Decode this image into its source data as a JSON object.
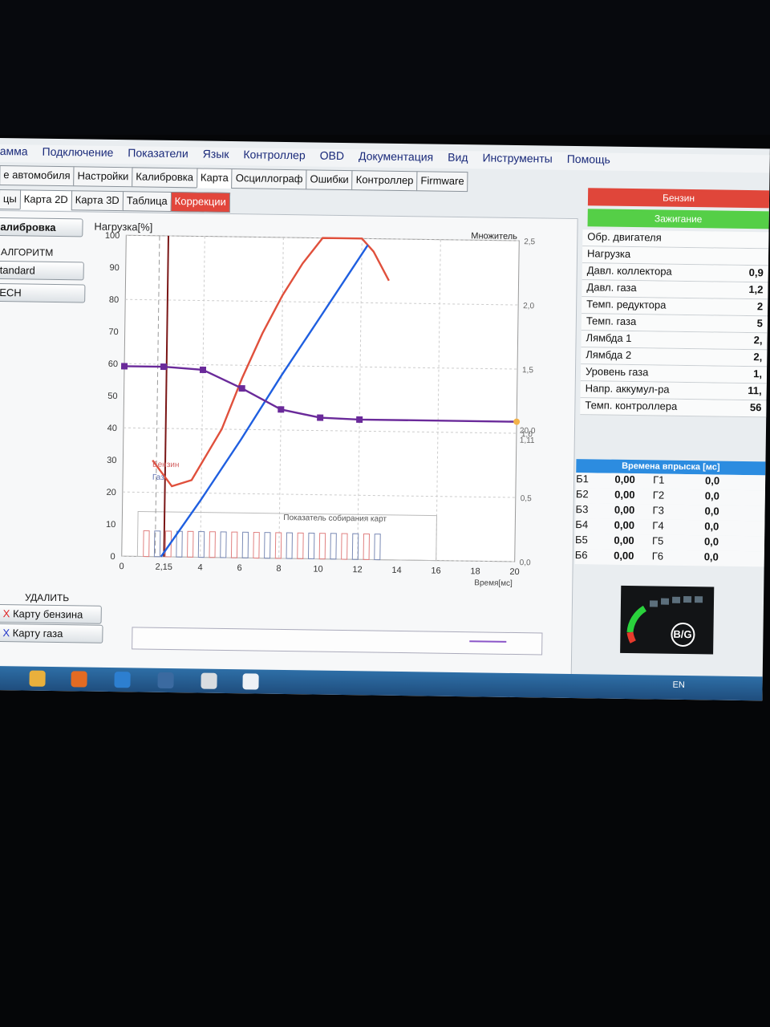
{
  "menu": [
    "амма",
    "Подключение",
    "Показатели",
    "Язык",
    "Контроллер",
    "OBD",
    "Документация",
    "Вид",
    "Инструменты",
    "Помощь"
  ],
  "tabs": [
    "е автомобиля",
    "Настройки",
    "Калибровка",
    "Карта",
    "Осциллограф",
    "Ошибки",
    "Контроллер",
    "Firmware"
  ],
  "subtabs": [
    "цы",
    "Карта 2D",
    "Карта 3D",
    "Таблица",
    "Коррекции"
  ],
  "left": {
    "calib_button": "алибровка",
    "algo_label": "АЛГОРИТМ",
    "algo_standard": "tandard",
    "algo_tech": "ECH",
    "delete_label": "УДАЛИТЬ",
    "delete_petrol": "Карту бензина",
    "delete_gas": "Карту газа",
    "x_mark": "X"
  },
  "chart_data": {
    "type": "line",
    "ylabel": "Нагрузка[%]",
    "y2label": "Множитель",
    "xlabel": "Время[мс]",
    "ylim": [
      0,
      100
    ],
    "y2lim": [
      0,
      2.5
    ],
    "xlim": [
      0,
      20
    ],
    "x_ticks": [
      "0",
      "2,15",
      "4",
      "6",
      "8",
      "10",
      "12",
      "14",
      "16",
      "18",
      "20"
    ],
    "y_ticks": [
      "0",
      "10",
      "20",
      "30",
      "40",
      "50",
      "60",
      "70",
      "80",
      "90",
      "100"
    ],
    "y2_ticks": [
      "0,0",
      "0,5",
      "1,0",
      "1,5",
      "2,0",
      "2,5"
    ],
    "marker_x": 2.15,
    "right_value_1": "20,0",
    "right_value_2": "1,11",
    "legend": [
      "Бензин",
      "Газ"
    ],
    "bars_title": "Показатель собирания карт",
    "series": [
      {
        "name": "Бензин",
        "color": "#e0503c",
        "x": [
          1.5,
          2.5,
          3.5,
          5,
          6,
          7,
          8,
          9,
          10,
          11,
          12,
          12.6,
          13.4
        ],
        "y": [
          30,
          22,
          24,
          40,
          56,
          70,
          82,
          92,
          100,
          100,
          100,
          96,
          87
        ]
      },
      {
        "name": "Газ",
        "color": "#1f5fe0",
        "x": [
          2.0,
          4,
          6,
          8,
          10,
          12.3
        ],
        "y": [
          0,
          18,
          37,
          57,
          76,
          98
        ]
      },
      {
        "name": "Множитель",
        "color": "#6a2a9a",
        "x": [
          0,
          2,
          4,
          6,
          8,
          10,
          12,
          20
        ],
        "y": [
          1.48,
          1.48,
          1.46,
          1.32,
          1.16,
          1.1,
          1.09,
          1.09
        ]
      }
    ]
  },
  "right": {
    "petrol": "Бензин",
    "ignition": "Зажигание",
    "params": [
      {
        "name": "Обр. двигателя",
        "value": ""
      },
      {
        "name": "Нагрузка",
        "value": ""
      },
      {
        "name": "Давл. коллектора",
        "value": "0,9"
      },
      {
        "name": "Давл. газа",
        "value": "1,2"
      },
      {
        "name": "Темп. редуктора",
        "value": "2"
      },
      {
        "name": "Темп. газа",
        "value": "5"
      },
      {
        "name": "Лямбда 1",
        "value": "2,"
      },
      {
        "name": "Лямбда 2",
        "value": "2,"
      },
      {
        "name": "Уровень газа",
        "value": "1,"
      },
      {
        "name": "Напр. аккумул-ра",
        "value": "11,"
      },
      {
        "name": "Темп. контроллера",
        "value": "56"
      }
    ],
    "inj_title": "Времена впрыска [мс]",
    "inj": [
      {
        "b": "Б1",
        "bv": "0,00",
        "g": "Г1",
        "gv": "0,0"
      },
      {
        "b": "Б2",
        "bv": "0,00",
        "g": "Г2",
        "gv": "0,0"
      },
      {
        "b": "Б3",
        "bv": "0,00",
        "g": "Г3",
        "gv": "0,0"
      },
      {
        "b": "Б4",
        "bv": "0,00",
        "g": "Г4",
        "gv": "0,0"
      },
      {
        "b": "Б5",
        "bv": "0,00",
        "g": "Г5",
        "gv": "0,0"
      },
      {
        "b": "Б6",
        "bv": "0,00",
        "g": "Г6",
        "gv": "0,0"
      }
    ],
    "logo_text": "B/G"
  },
  "taskbar": {
    "lang": "EN"
  }
}
